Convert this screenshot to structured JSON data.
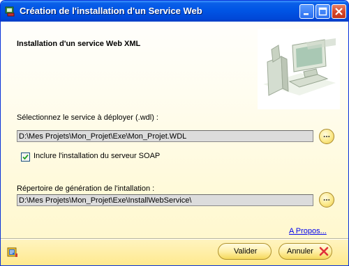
{
  "window": {
    "title": "Création de l'installation d'un Service Web",
    "controls": {
      "minimize": "minimize-icon",
      "maximize": "maximize-icon",
      "close": "close-icon"
    }
  },
  "heading": "Installation d'un service Web XML",
  "service": {
    "label": "Sélectionnez le service à déployer (.wdl) :",
    "value": "D:\\Mes Projets\\Mon_Projet\\Exe\\Mon_Projet.WDL",
    "browse_label": "..."
  },
  "soap_checkbox": {
    "label": "Inclure l'installation du serveur SOAP",
    "checked": true
  },
  "output": {
    "label": "Répertoire de génération de l'intallation :",
    "value": "D:\\Mes Projets\\Mon_Projet\\Exe\\InstallWebService\\",
    "browse_label": "..."
  },
  "about_link": "A Propos...",
  "buttons": {
    "validate": "Valider",
    "cancel": "Annuler"
  },
  "colors": {
    "titlebar": "#0055e5",
    "background_bottom": "#fff7c8",
    "button_fill": "#fff0a8",
    "link": "#0000ee",
    "cancel_icon": "#e0303a"
  }
}
